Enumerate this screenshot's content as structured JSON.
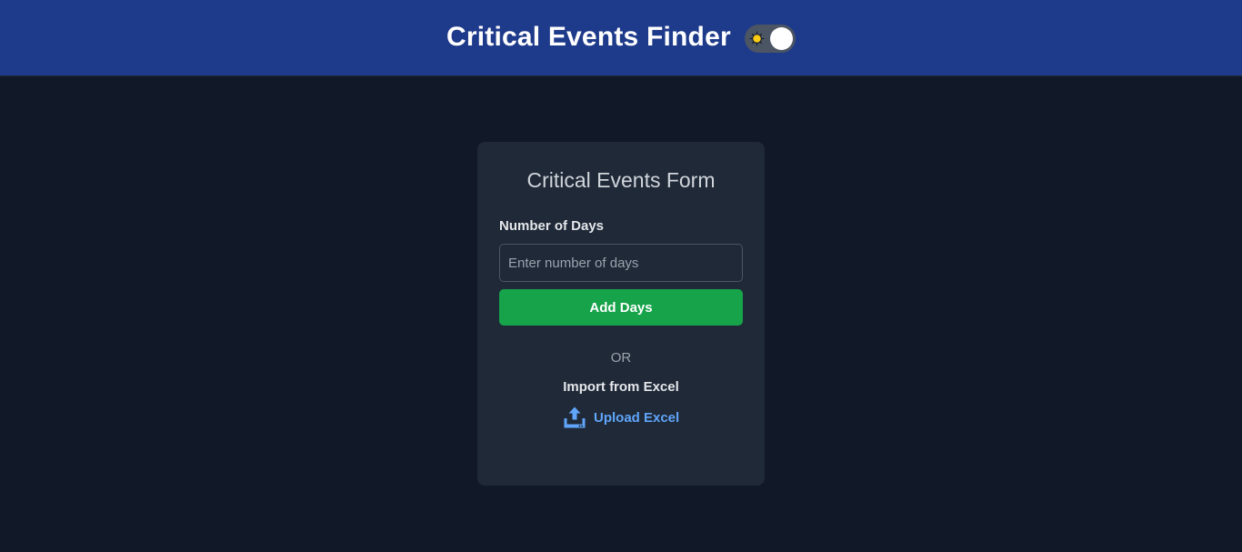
{
  "header": {
    "title": "Critical Events Finder",
    "theme_toggle_icon": "sun-icon"
  },
  "form": {
    "title": "Critical Events Form",
    "days_label": "Number of Days",
    "days_placeholder": "Enter number of days",
    "days_value": "",
    "add_button_label": "Add Days",
    "separator": "OR",
    "import_label": "Import from Excel",
    "upload_label": "Upload Excel",
    "upload_icon": "upload-icon"
  },
  "colors": {
    "header_bg": "#1e3a8a",
    "page_bg": "#111827",
    "card_bg": "#1f2937",
    "primary_button": "#16a34a",
    "link": "#60a5fa"
  }
}
